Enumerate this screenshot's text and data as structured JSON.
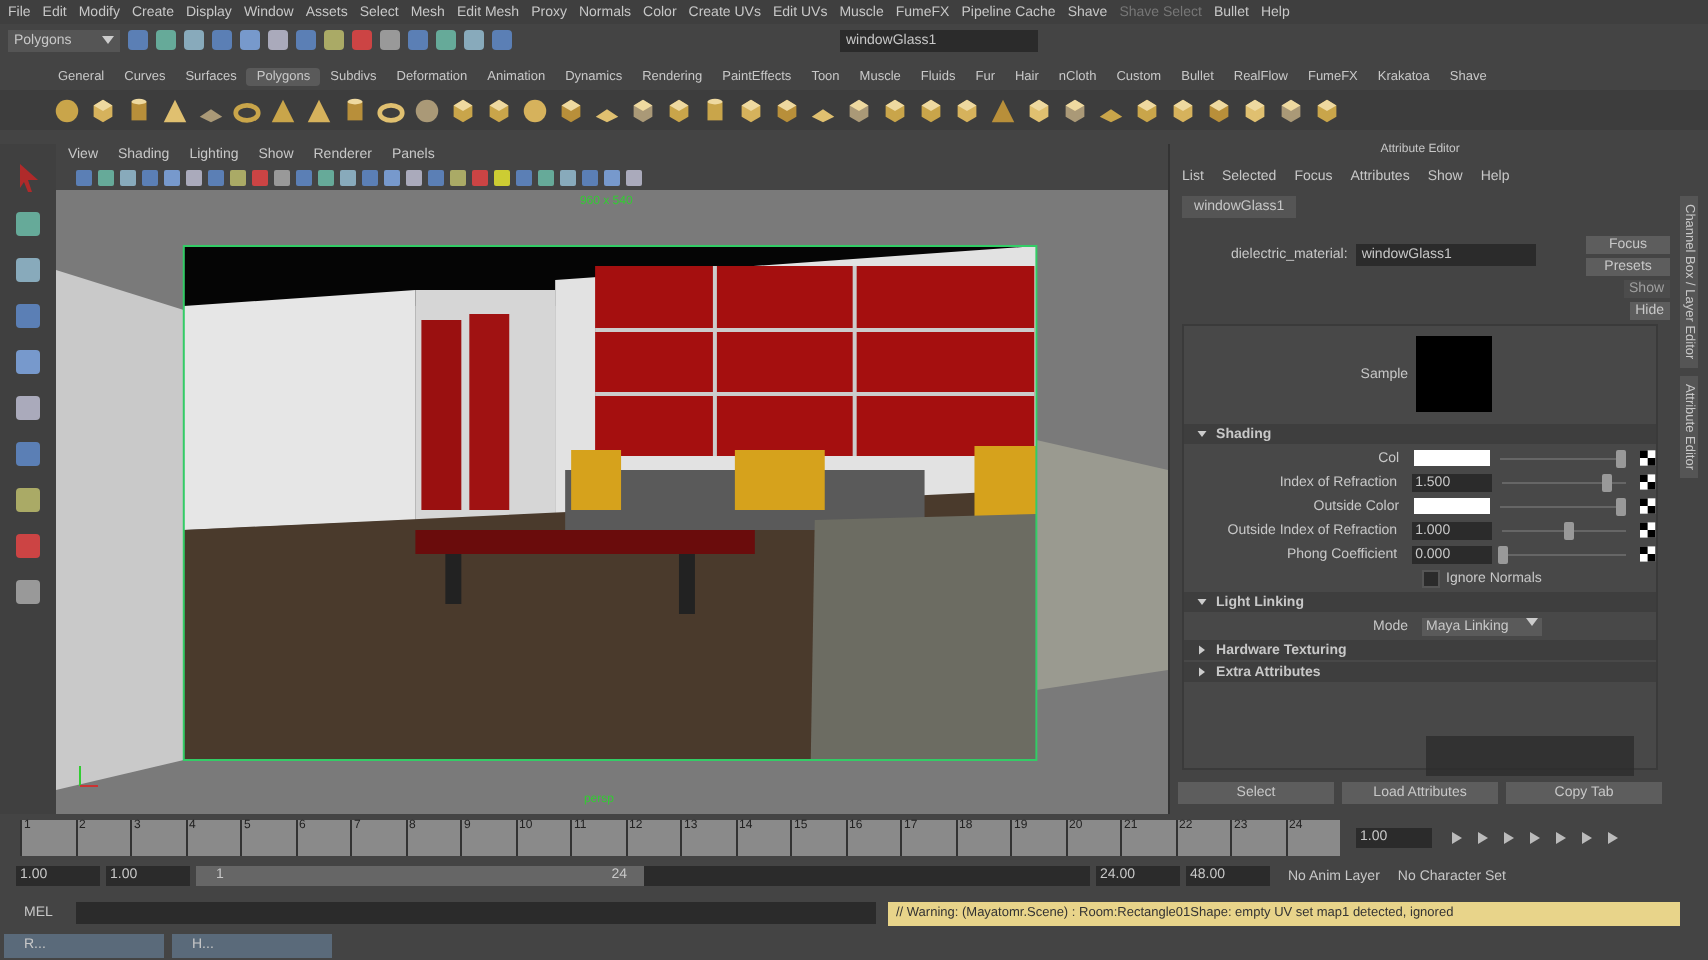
{
  "menu_bar": [
    {
      "label": "File",
      "disabled": false
    },
    {
      "label": "Edit",
      "disabled": false
    },
    {
      "label": "Modify",
      "disabled": false
    },
    {
      "label": "Create",
      "disabled": false
    },
    {
      "label": "Display",
      "disabled": false
    },
    {
      "label": "Window",
      "disabled": false
    },
    {
      "label": "Assets",
      "disabled": false
    },
    {
      "label": "Select",
      "disabled": false
    },
    {
      "label": "Mesh",
      "disabled": false
    },
    {
      "label": "Edit Mesh",
      "disabled": false
    },
    {
      "label": "Proxy",
      "disabled": false
    },
    {
      "label": "Normals",
      "disabled": false
    },
    {
      "label": "Color",
      "disabled": false
    },
    {
      "label": "Create UVs",
      "disabled": false
    },
    {
      "label": "Edit UVs",
      "disabled": false
    },
    {
      "label": "Muscle",
      "disabled": false
    },
    {
      "label": "FumeFX",
      "disabled": false
    },
    {
      "label": "Pipeline Cache",
      "disabled": false
    },
    {
      "label": "Shave",
      "disabled": false
    },
    {
      "label": "Shave Select",
      "disabled": true
    },
    {
      "label": "Bullet",
      "disabled": false
    },
    {
      "label": "Help",
      "disabled": false
    }
  ],
  "status_line": {
    "menu_set": "Polygons",
    "name_field": "windowGlass1"
  },
  "shelf_tabs": [
    {
      "label": "General",
      "selected": false
    },
    {
      "label": "Curves",
      "selected": false
    },
    {
      "label": "Surfaces",
      "selected": false
    },
    {
      "label": "Polygons",
      "selected": true
    },
    {
      "label": "Subdivs",
      "selected": false
    },
    {
      "label": "Deformation",
      "selected": false
    },
    {
      "label": "Animation",
      "selected": false
    },
    {
      "label": "Dynamics",
      "selected": false
    },
    {
      "label": "Rendering",
      "selected": false
    },
    {
      "label": "PaintEffects",
      "selected": false
    },
    {
      "label": "Toon",
      "selected": false
    },
    {
      "label": "Muscle",
      "selected": false
    },
    {
      "label": "Fluids",
      "selected": false
    },
    {
      "label": "Fur",
      "selected": false
    },
    {
      "label": "Hair",
      "selected": false
    },
    {
      "label": "nCloth",
      "selected": false
    },
    {
      "label": "Custom",
      "selected": false
    },
    {
      "label": "Bullet",
      "selected": false
    },
    {
      "label": "RealFlow",
      "selected": false
    },
    {
      "label": "FumeFX",
      "selected": false
    },
    {
      "label": "Krakatoa",
      "selected": false
    },
    {
      "label": "Shave",
      "selected": false
    }
  ],
  "viewport": {
    "menus": [
      "View",
      "Shading",
      "Lighting",
      "Show",
      "Renderer",
      "Panels"
    ],
    "resolution": "960 x 540",
    "camera": "persp"
  },
  "attribute_editor": {
    "title": "Attribute Editor",
    "menus": [
      "List",
      "Selected",
      "Focus",
      "Attributes",
      "Show",
      "Help"
    ],
    "node_tab": "windowGlass1",
    "node_label": "dielectric_material:",
    "node_name": "windowGlass1",
    "buttons": [
      {
        "label": "Focus",
        "disabled": false
      },
      {
        "label": "Presets",
        "disabled": false
      },
      {
        "label": "Show",
        "disabled": true
      },
      {
        "label": "Hide",
        "disabled": false
      }
    ],
    "sample_label": "Sample",
    "sections": [
      {
        "title": "Shading",
        "expanded": true,
        "rows": [
          {
            "kind": "color",
            "label": "Col",
            "level": 0.96
          },
          {
            "kind": "number",
            "label": "Index of Refraction",
            "value": "1.500",
            "level": 0.85
          },
          {
            "kind": "color",
            "label": "Outside Color",
            "level": 0.97
          },
          {
            "kind": "number",
            "label": "Outside Index of Refraction",
            "value": "1.000",
            "level": 0.55
          },
          {
            "kind": "number",
            "label": "Phong Coefficient",
            "value": "0.000",
            "level": 0.02
          },
          {
            "kind": "checkbox",
            "label": "Ignore Normals",
            "checked": false
          }
        ]
      },
      {
        "title": "Light Linking",
        "expanded": true,
        "rows": [
          {
            "kind": "dropdown",
            "label": "Mode",
            "value": "Maya Linking"
          }
        ]
      },
      {
        "title": "Hardware Texturing",
        "expanded": false
      },
      {
        "title": "Extra Attributes",
        "expanded": false
      }
    ],
    "bottom_buttons": [
      "Select",
      "Load Attributes",
      "Copy Tab"
    ]
  },
  "side_tabs": [
    "Channel Box / Layer Editor",
    "Attribute Editor"
  ],
  "time_slider": {
    "frames": [
      "1",
      "2",
      "3",
      "4",
      "5",
      "6",
      "7",
      "8",
      "9",
      "10",
      "11",
      "12",
      "13",
      "14",
      "15",
      "16",
      "17",
      "18",
      "19",
      "20",
      "21",
      "22",
      "23",
      "24"
    ],
    "current_time": "1.00"
  },
  "range_slider": {
    "start": "1.00",
    "playback_start": "1.00",
    "slider_start": "1",
    "slider_end": "24",
    "level": 0.5,
    "playback_end": "24.00",
    "end": "48.00",
    "anim_layer": "No Anim Layer",
    "character_set": "No Character Set"
  },
  "command_line": {
    "language": "MEL",
    "message": "// Warning: (Mayatomr.Scene) : Room:Rectangle01Shape: empty UV set map1 detected, ignored"
  },
  "taskbar": [
    "R...",
    "H..."
  ]
}
